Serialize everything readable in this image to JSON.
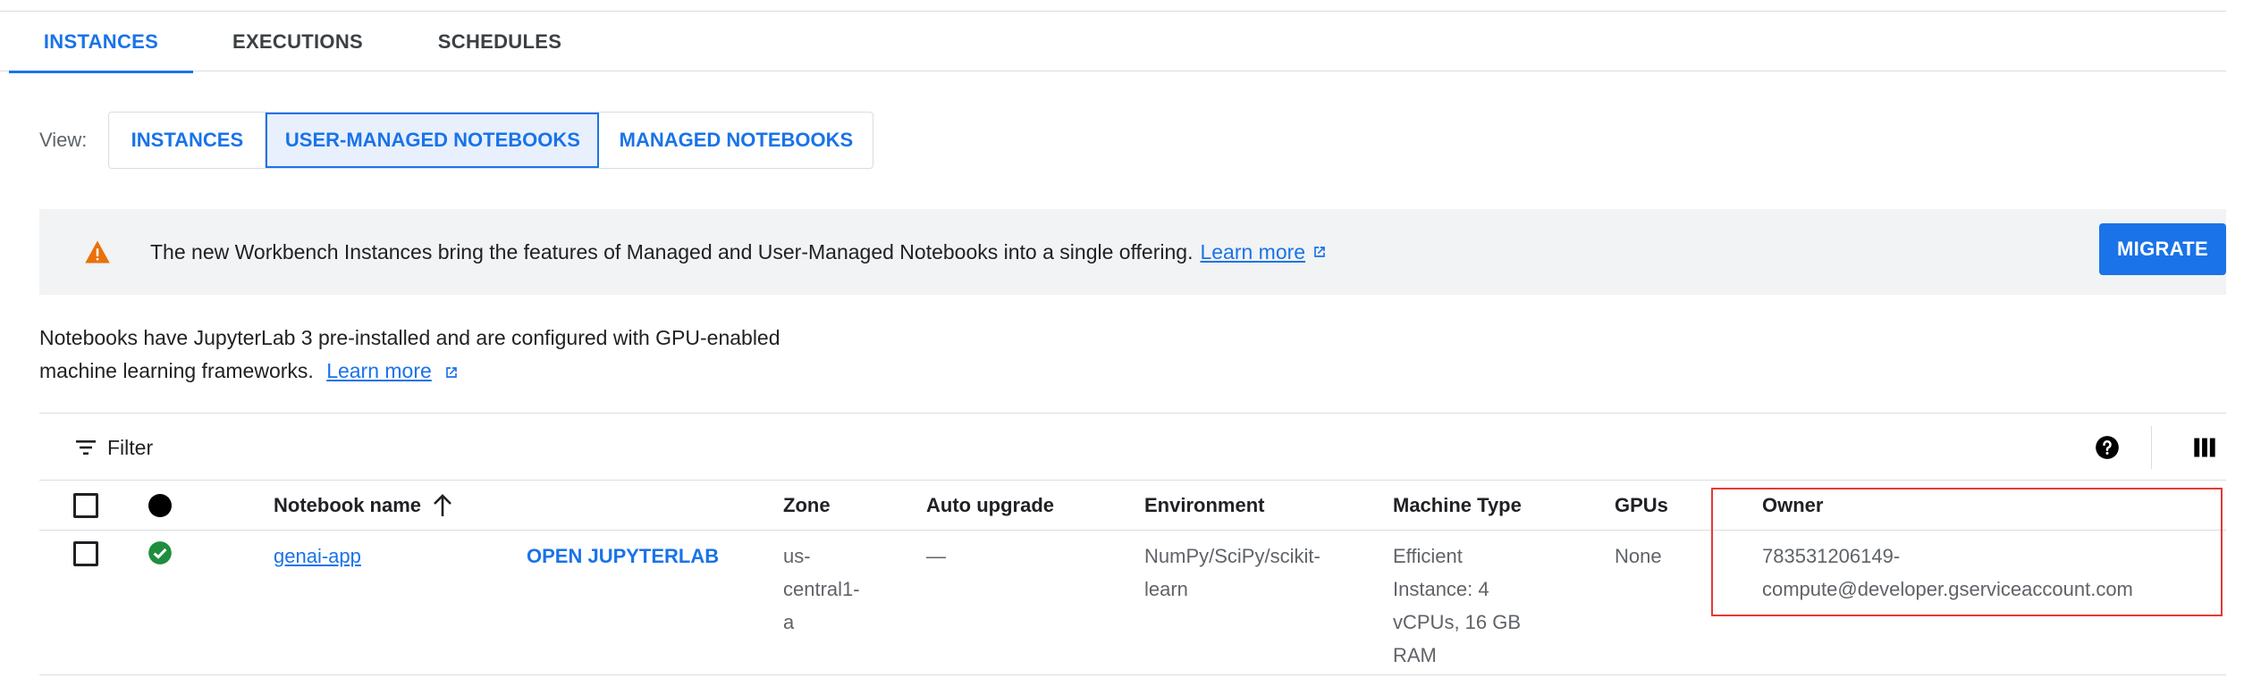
{
  "tabs": [
    {
      "label": "INSTANCES",
      "active": true
    },
    {
      "label": "EXECUTIONS",
      "active": false
    },
    {
      "label": "SCHEDULES",
      "active": false
    }
  ],
  "view": {
    "label": "View:",
    "options": [
      "INSTANCES",
      "USER-MANAGED NOTEBOOKS",
      "MANAGED NOTEBOOKS"
    ],
    "selected": "USER-MANAGED NOTEBOOKS"
  },
  "banner": {
    "icon": "warning-icon",
    "text": "The new Workbench Instances bring the features of Managed and User-Managed Notebooks into a single offering.",
    "link": "Learn more",
    "button": "MIGRATE"
  },
  "description": {
    "line1": "Notebooks have JupyterLab 3 pre-installed and are configured with GPU-enabled",
    "line2": "machine learning frameworks.",
    "link": "Learn more"
  },
  "toolbar": {
    "filter_label": "Filter",
    "icons": [
      "filter-icon",
      "help-icon",
      "column-display-icon"
    ]
  },
  "table": {
    "headers": {
      "name": "Notebook name",
      "zone": "Zone",
      "auto_upgrade": "Auto upgrade",
      "environment": "Environment",
      "machine_type": "Machine Type",
      "gpus": "GPUs",
      "owner": "Owner"
    },
    "rows": [
      {
        "status": "running",
        "name": "genai-app",
        "action": "OPEN JUPYTERLAB",
        "zone": [
          "us-",
          "central1-",
          "a"
        ],
        "auto_upgrade": "—",
        "environment": [
          "NumPy/SciPy/scikit-",
          "learn"
        ],
        "machine_type": [
          "Efficient",
          "Instance: 4",
          "vCPUs, 16 GB",
          "RAM"
        ],
        "gpus": "None",
        "owner": [
          "783531206149-",
          "compute@developer.gserviceaccount.com"
        ]
      }
    ]
  },
  "colors": {
    "accent": "#1a73e8",
    "warning": "#e8710a",
    "success": "#1e8e3e",
    "highlight": "#e53935"
  }
}
